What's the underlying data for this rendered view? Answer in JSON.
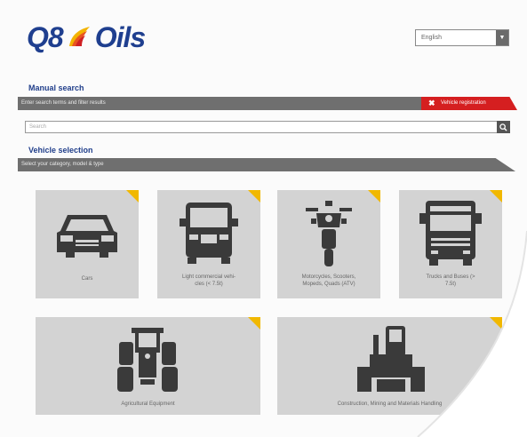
{
  "brand": {
    "logo_left": "Q8",
    "logo_right": "Oils"
  },
  "language": {
    "selected": "English"
  },
  "manual_search": {
    "title": "Manual search",
    "instruction": "Enter search terms and filter results",
    "vehicle_registration_label": "Vehicle registration",
    "search_placeholder": "Search"
  },
  "vehicle_selection": {
    "title": "Vehicle selection",
    "instruction": "Select your category, model & type",
    "categories": [
      {
        "label": "Cars",
        "icon": "car-icon"
      },
      {
        "label": "Light commercial vehi-\ncles (< 7.5t)",
        "icon": "van-icon"
      },
      {
        "label": "Motorcycles, Scooters,\nMopeds, Quads (ATV)",
        "icon": "motorcycle-icon"
      },
      {
        "label": "Trucks and Buses (>\n7.5t)",
        "icon": "truck-icon"
      },
      {
        "label": "Agricultural Equipment",
        "icon": "tractor-icon"
      },
      {
        "label": "Construction, Mining and Materials Handling",
        "icon": "construction-icon"
      }
    ]
  },
  "colors": {
    "brand_blue": "#1f3f8b",
    "accent_red": "#d51f20",
    "corner_yellow": "#f1b800",
    "tile_grey": "#d3d3d3",
    "bar_grey": "#6f6f6f"
  }
}
